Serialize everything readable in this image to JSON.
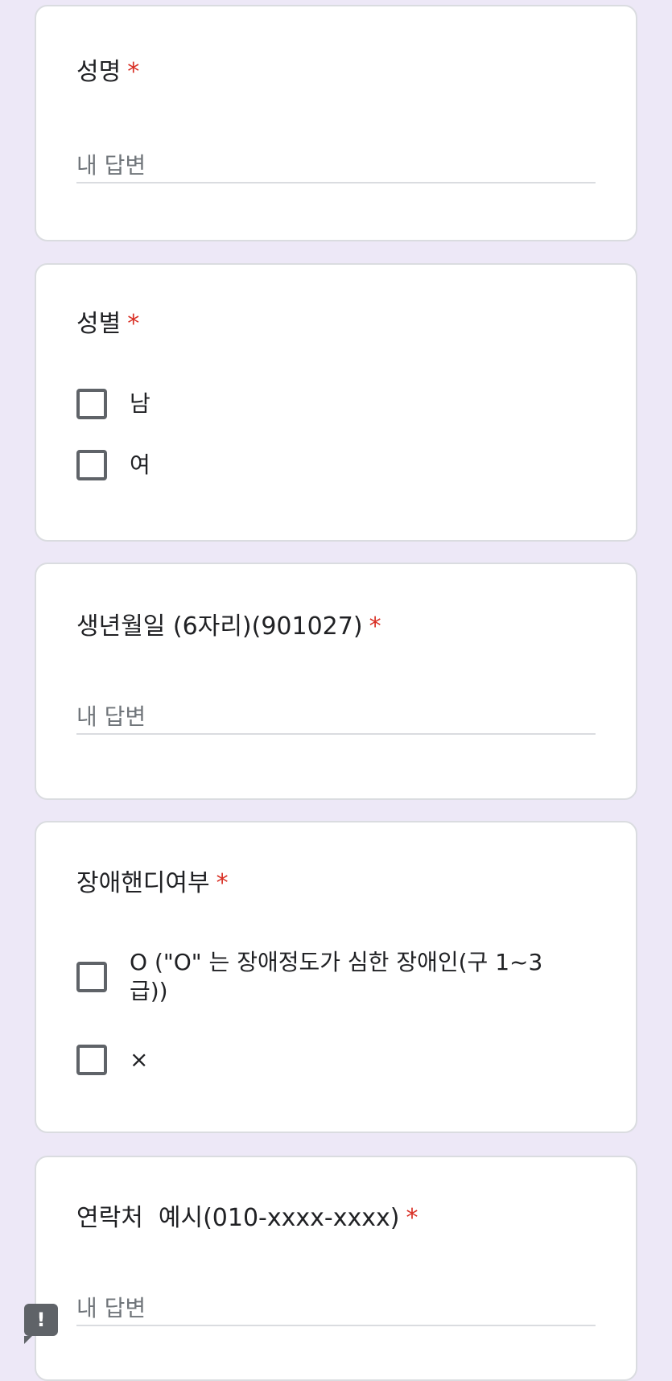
{
  "questions": [
    {
      "title": "성명",
      "required_mark": "*",
      "placeholder": "내 답변"
    },
    {
      "title": "성별",
      "required_mark": "*",
      "options": [
        "남",
        "여"
      ]
    },
    {
      "title": "생년월일 (6자리)(901027)",
      "required_mark": "*",
      "placeholder": "내 답변"
    },
    {
      "title": "장애핸디여부",
      "required_mark": "*",
      "options": [
        "O (\"O\" 는  장애정도가 심한 장애인(구 1~3급))",
        "×"
      ]
    },
    {
      "title": "연락처  예시(010-xxxx-xxxx)",
      "required_mark": "*",
      "placeholder": "내 답변"
    }
  ],
  "report_button": {
    "icon": "report-icon",
    "glyph": "!"
  },
  "colors": {
    "background": "#ede8f7",
    "required": "#d93025",
    "card_border": "#dadce0"
  }
}
